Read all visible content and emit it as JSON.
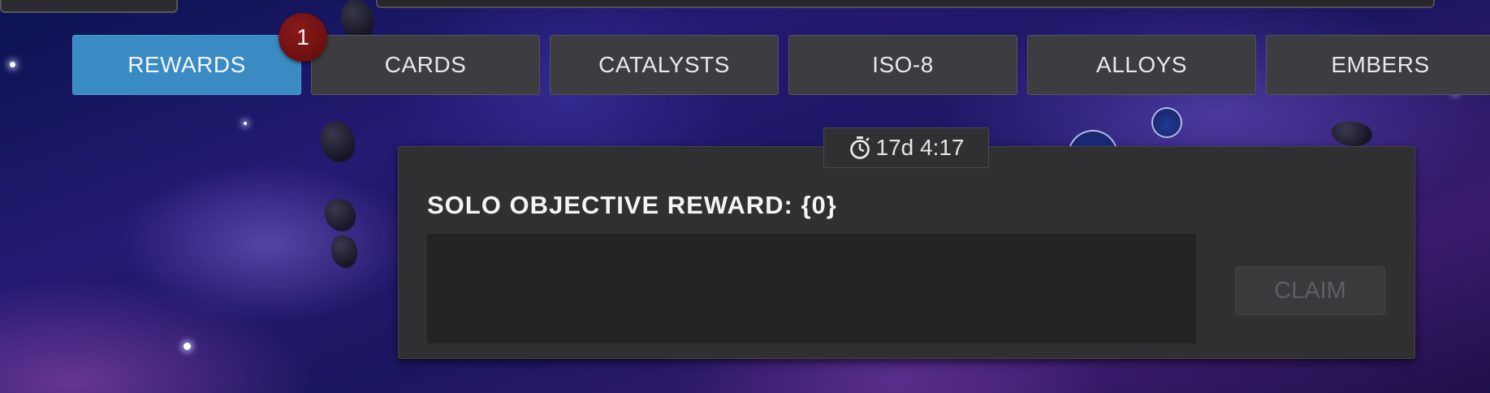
{
  "tabs": [
    {
      "label": "REWARDS",
      "active": true
    },
    {
      "label": "CARDS",
      "active": false
    },
    {
      "label": "CATALYSTS",
      "active": false
    },
    {
      "label": "ISO-8",
      "active": false
    },
    {
      "label": "ALLOYS",
      "active": false
    },
    {
      "label": "EMBERS",
      "active": false
    }
  ],
  "notification_badge": {
    "count": "1"
  },
  "objective_panel": {
    "timer": "17d 4:17",
    "timer_icon": "stopwatch-icon",
    "title": "SOLO OBJECTIVE REWARD: {0}",
    "claim_label": "CLAIM",
    "claim_enabled": false
  },
  "colors": {
    "active_tab": "#3a8bc3",
    "inactive_tab": "#3d3d41",
    "badge": "#7a1010",
    "panel": "#303033"
  }
}
